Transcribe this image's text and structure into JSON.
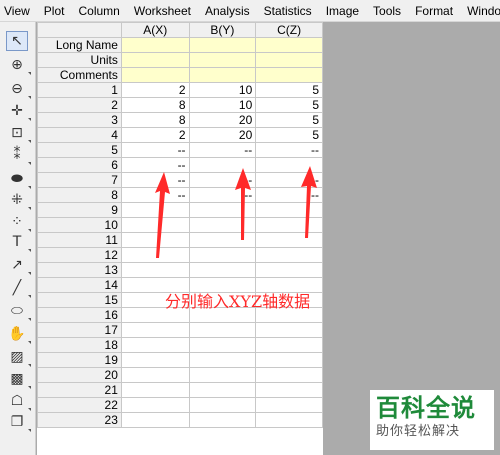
{
  "menu": {
    "items": [
      "View",
      "Plot",
      "Column",
      "Worksheet",
      "Analysis",
      "Statistics",
      "Image",
      "Tools",
      "Format",
      "Window"
    ]
  },
  "toolbar": {
    "tools": [
      {
        "name": "pointer-icon",
        "glyph": "↖"
      },
      {
        "name": "zoom-in-icon",
        "glyph": "⊕"
      },
      {
        "name": "zoom-out-icon",
        "glyph": "⊖"
      },
      {
        "name": "screen-reader-icon",
        "glyph": "✛"
      },
      {
        "name": "data-selector-icon",
        "glyph": "⊡"
      },
      {
        "name": "data-reader-icon",
        "glyph": "⁑"
      },
      {
        "name": "region-selector-icon",
        "glyph": "⬬"
      },
      {
        "name": "scale-icon",
        "glyph": "⁜"
      },
      {
        "name": "draw-data-icon",
        "glyph": "⁘"
      },
      {
        "name": "text-tool-icon",
        "glyph": "T"
      },
      {
        "name": "arrow-tool-icon",
        "glyph": "↗"
      },
      {
        "name": "line-tool-icon",
        "glyph": "╱"
      },
      {
        "name": "ellipse-tool-icon",
        "glyph": "⬭"
      },
      {
        "name": "hand-tool-icon",
        "glyph": "✋"
      },
      {
        "name": "add-graph-icon",
        "glyph": "▨"
      },
      {
        "name": "insert-graph-icon",
        "glyph": "▩"
      },
      {
        "name": "mask-icon",
        "glyph": "☖"
      },
      {
        "name": "layer-icon",
        "glyph": "❐"
      }
    ]
  },
  "sheet": {
    "columns": [
      "A(X)",
      "B(Y)",
      "C(Z)"
    ],
    "meta_rows": [
      "Long Name",
      "Units",
      "Comments"
    ],
    "rows": [
      {
        "num": "1",
        "cells": [
          "2",
          "10",
          "5"
        ]
      },
      {
        "num": "2",
        "cells": [
          "8",
          "10",
          "5"
        ]
      },
      {
        "num": "3",
        "cells": [
          "8",
          "20",
          "5"
        ]
      },
      {
        "num": "4",
        "cells": [
          "2",
          "20",
          "5"
        ]
      },
      {
        "num": "5",
        "cells": [
          "--",
          "--",
          "--"
        ]
      },
      {
        "num": "6",
        "cells": [
          "--",
          "",
          ""
        ]
      },
      {
        "num": "7",
        "cells": [
          "--",
          "--",
          "--"
        ]
      },
      {
        "num": "8",
        "cells": [
          "--",
          "--",
          "--"
        ]
      },
      {
        "num": "9",
        "cells": [
          "",
          "",
          ""
        ]
      },
      {
        "num": "10",
        "cells": [
          "",
          "",
          ""
        ]
      },
      {
        "num": "11",
        "cells": [
          "",
          "",
          ""
        ]
      },
      {
        "num": "12",
        "cells": [
          "",
          "",
          ""
        ]
      },
      {
        "num": "13",
        "cells": [
          "",
          "",
          ""
        ]
      },
      {
        "num": "14",
        "cells": [
          "",
          "",
          ""
        ]
      },
      {
        "num": "15",
        "cells": [
          "",
          "",
          ""
        ]
      },
      {
        "num": "16",
        "cells": [
          "",
          "",
          ""
        ]
      },
      {
        "num": "17",
        "cells": [
          "",
          "",
          ""
        ]
      },
      {
        "num": "18",
        "cells": [
          "",
          "",
          ""
        ]
      },
      {
        "num": "19",
        "cells": [
          "",
          "",
          ""
        ]
      },
      {
        "num": "20",
        "cells": [
          "",
          "",
          ""
        ]
      },
      {
        "num": "21",
        "cells": [
          "",
          "",
          ""
        ]
      },
      {
        "num": "22",
        "cells": [
          "",
          "",
          ""
        ]
      },
      {
        "num": "23",
        "cells": [
          "",
          "",
          ""
        ]
      }
    ]
  },
  "annotation": {
    "text": "分别输入XYZ轴数据",
    "color": "#ff2a2a"
  },
  "watermark": {
    "title": "百科全说",
    "subtitle": "助你轻松解决"
  }
}
